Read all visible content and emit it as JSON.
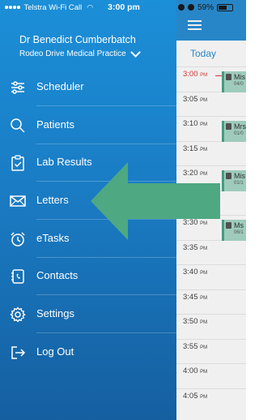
{
  "status_bar": {
    "carrier": "Telstra Wi-Fi Call",
    "time": "3:00 pm",
    "battery": "59%"
  },
  "user": {
    "name": "Dr Benedict Cumberbatch",
    "practice": "Rodeo Drive Medical Practice"
  },
  "menu": [
    {
      "label": "Scheduler",
      "icon": "scheduler-icon"
    },
    {
      "label": "Patients",
      "icon": "search-icon"
    },
    {
      "label": "Lab Results",
      "icon": "clipboard-check-icon"
    },
    {
      "label": "Letters",
      "icon": "envelope-icon"
    },
    {
      "label": "eTasks",
      "icon": "alarm-clock-icon"
    },
    {
      "label": "Contacts",
      "icon": "address-book-icon"
    },
    {
      "label": "Settings",
      "icon": "gear-icon"
    },
    {
      "label": "Log Out",
      "icon": "logout-icon"
    }
  ],
  "scheduler": {
    "today_label": "Today",
    "times": [
      {
        "time": "3:00",
        "ampm": "PM"
      },
      {
        "time": "3:05",
        "ampm": "PM"
      },
      {
        "time": "3:10",
        "ampm": "PM"
      },
      {
        "time": "3:15",
        "ampm": "PM"
      },
      {
        "time": "3:20",
        "ampm": "PM"
      },
      {
        "time": "3:25",
        "ampm": "PM"
      },
      {
        "time": "3:30",
        "ampm": "PM"
      },
      {
        "time": "3:35",
        "ampm": "PM"
      },
      {
        "time": "3:40",
        "ampm": "PM"
      },
      {
        "time": "3:45",
        "ampm": "PM"
      },
      {
        "time": "3:50",
        "ampm": "PM"
      },
      {
        "time": "3:55",
        "ampm": "PM"
      },
      {
        "time": "4:00",
        "ampm": "PM"
      },
      {
        "time": "4:05",
        "ampm": "PM"
      }
    ],
    "appointments": [
      {
        "name": "Mis",
        "date": "04/0"
      },
      {
        "name": "Mrs",
        "date": "01/0"
      },
      {
        "name": "Mis",
        "date": "01/1"
      },
      {
        "name": "Ms",
        "date": "06/1"
      }
    ]
  },
  "colors": {
    "drawer_top": "#1b8fd8",
    "drawer_bottom": "#155fa0",
    "accent": "#2a8fd5",
    "now_line": "#e53935",
    "appointment": "#a8d8c8",
    "arrow": "#4ea882"
  }
}
